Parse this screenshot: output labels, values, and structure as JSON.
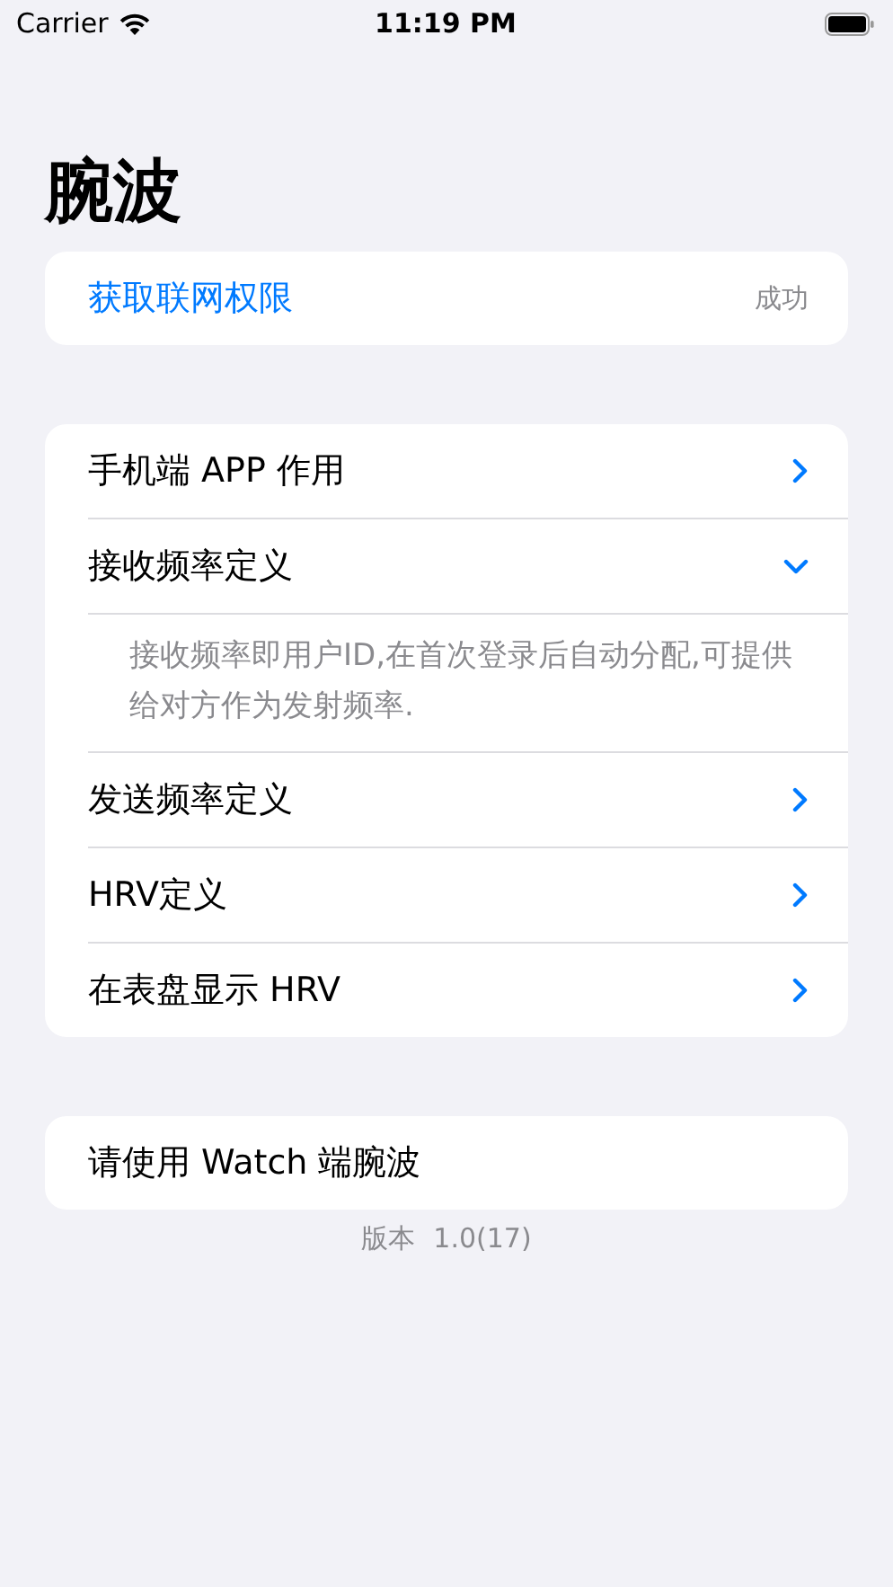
{
  "status_bar": {
    "carrier": "Carrier",
    "time": "11:19 PM"
  },
  "title": "腕波",
  "network": {
    "label": "获取联网权限",
    "status": "成功"
  },
  "items": [
    {
      "label": "手机端 APP 作用",
      "expanded": false
    },
    {
      "label": "接收频率定义",
      "expanded": true,
      "description": "接收频率即用户ID,在首次登录后自动分配,可提供给对方作为发射频率."
    },
    {
      "label": "发送频率定义",
      "expanded": false
    },
    {
      "label": "HRV定义",
      "expanded": false
    },
    {
      "label": "在表盘显示 HRV",
      "expanded": false
    }
  ],
  "watch_row": {
    "label": "请使用 Watch 端腕波"
  },
  "version": {
    "label": "版本",
    "number": "1.0(17)"
  }
}
